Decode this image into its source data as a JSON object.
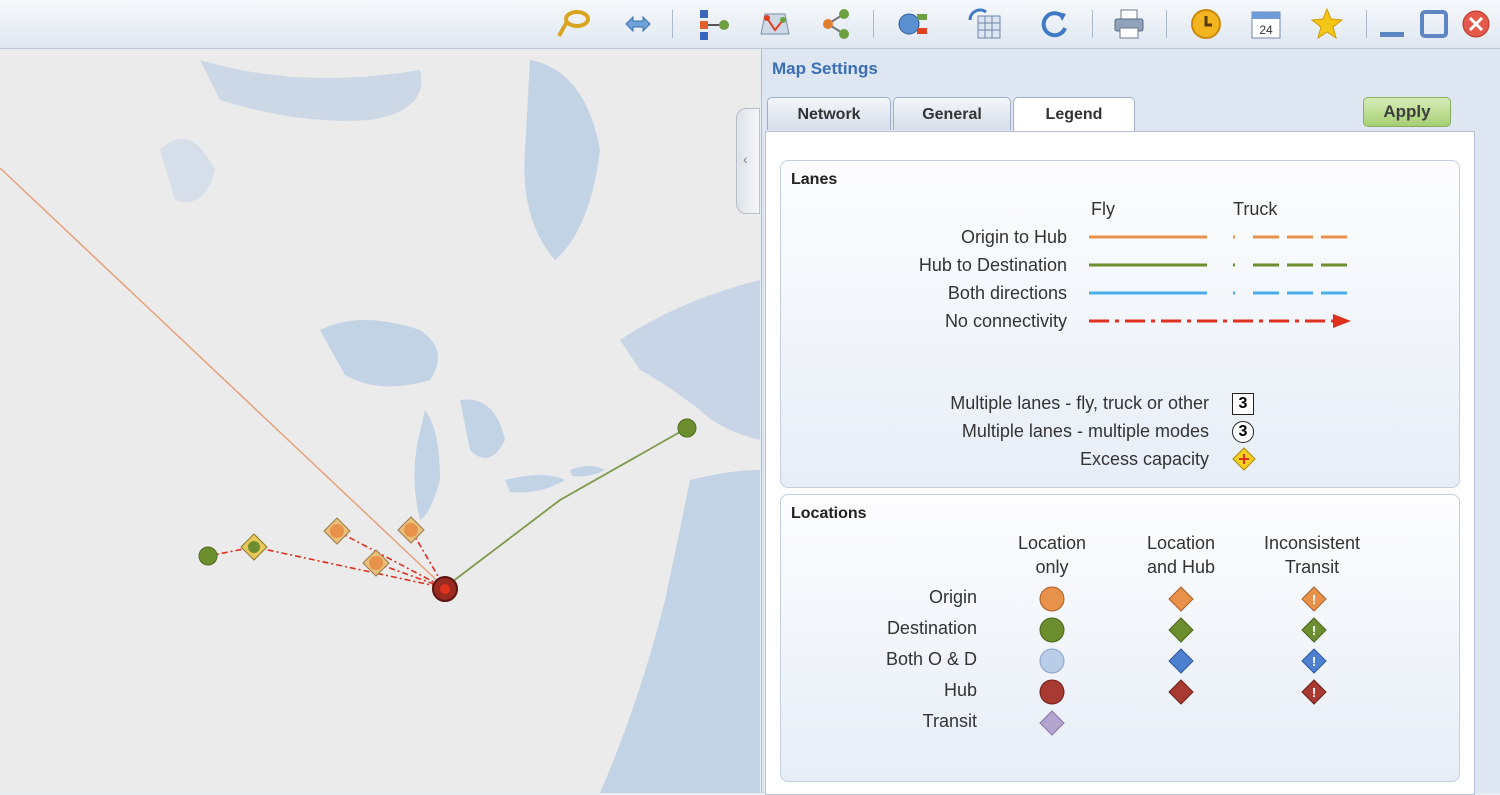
{
  "toolbar": {
    "icons": [
      "lasso-icon",
      "swap-arrows-icon",
      "network-tree-icon",
      "map-network-icon",
      "share-nodes-icon",
      "network-map-icon",
      "refresh-table-icon",
      "refresh-icon",
      "print-icon",
      "clock-icon",
      "calendar-icon",
      "star-icon",
      "minimize-icon",
      "maximize-icon",
      "close-icon"
    ],
    "calendar_day": "24"
  },
  "panel": {
    "title": "Map Settings",
    "tabs": [
      {
        "label": "Network",
        "active": false
      },
      {
        "label": "General",
        "active": false
      },
      {
        "label": "Legend",
        "active": true
      }
    ],
    "apply_label": "Apply"
  },
  "lanes": {
    "title": "Lanes",
    "col_fly": "Fly",
    "col_truck": "Truck",
    "rows": [
      {
        "label": "Origin to Hub",
        "color": "#e8914a"
      },
      {
        "label": "Hub to Destination",
        "color": "#6c8e2f"
      },
      {
        "label": "Both directions",
        "color": "#4aaee8"
      },
      {
        "label": "No connectivity",
        "color": "#e0301e"
      }
    ],
    "multi": [
      {
        "label": "Multiple lanes - fly, truck or other",
        "badge": "3"
      },
      {
        "label": "Multiple lanes - multiple modes",
        "badge": "3"
      },
      {
        "label": "Excess capacity",
        "badge": ""
      }
    ]
  },
  "locations": {
    "title": "Locations",
    "col1": [
      "Location",
      "only"
    ],
    "col2": [
      "Location",
      "and Hub"
    ],
    "col3": [
      "Inconsistent",
      "Transit"
    ],
    "rows": [
      {
        "label": "Origin",
        "color": "#e8914a"
      },
      {
        "label": "Destination",
        "color": "#6c8e2f"
      },
      {
        "label": "Both O & D",
        "color_circle": "#b9cde9",
        "color": "#4f80d0"
      },
      {
        "label": "Hub",
        "color": "#a83a32"
      },
      {
        "label": "Transit",
        "color": "#b3a3cf"
      }
    ]
  },
  "colors": {
    "accent": "#3b6fb6",
    "origin": "#e8914a",
    "destination": "#6c8e2f",
    "hub": "#a83a32",
    "no_connectivity": "#e0301e"
  }
}
